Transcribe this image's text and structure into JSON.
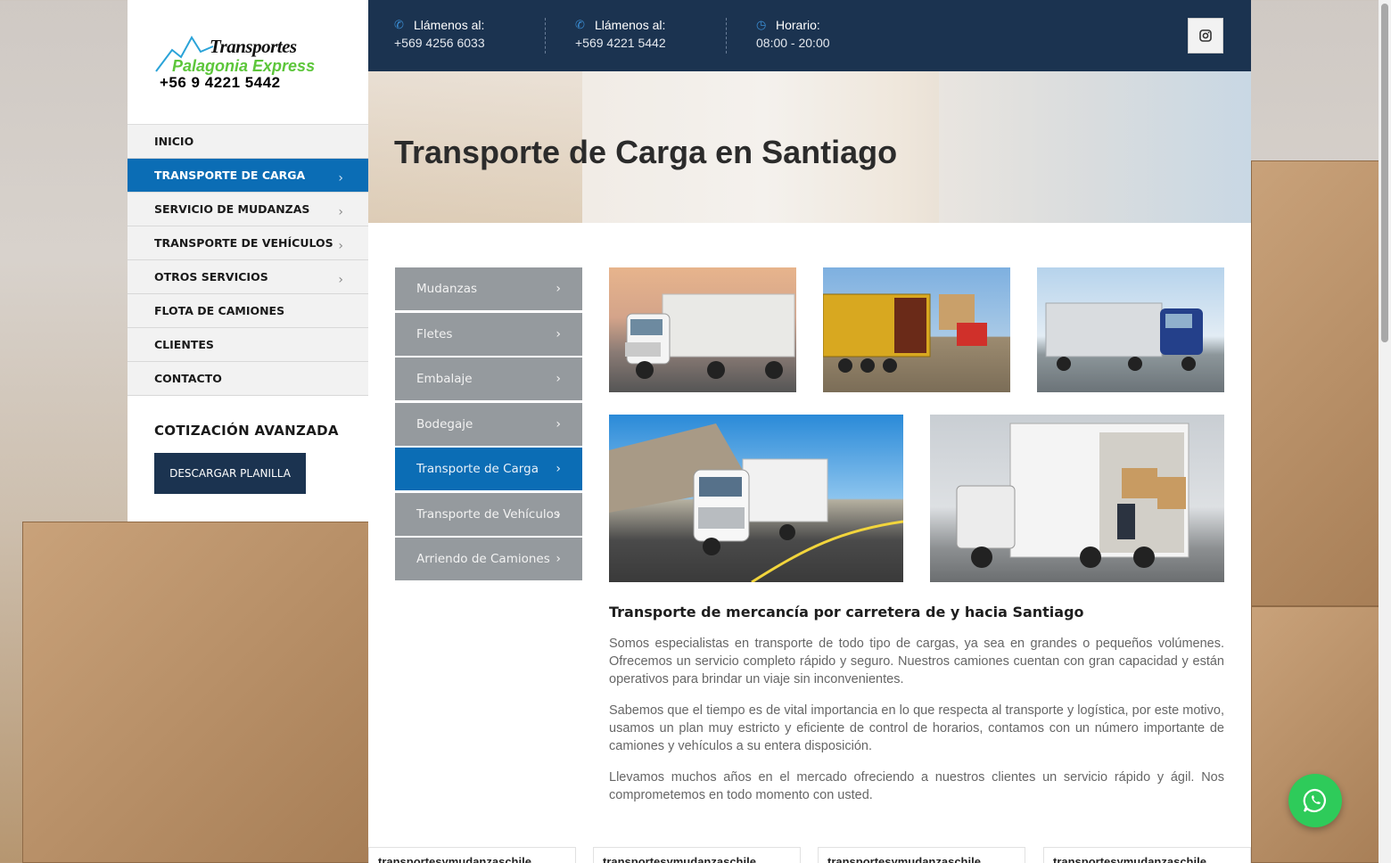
{
  "logo": {
    "line1": "Transportes",
    "line2": "Palagonia Express",
    "phone": "+56 9 4221 5442"
  },
  "nav": {
    "items": [
      {
        "label": "INICIO",
        "active": false,
        "submenu": false
      },
      {
        "label": "TRANSPORTE DE CARGA",
        "active": true,
        "submenu": true
      },
      {
        "label": "SERVICIO DE MUDANZAS",
        "active": false,
        "submenu": true
      },
      {
        "label": "TRANSPORTE DE VEHÍCULOS",
        "active": false,
        "submenu": true
      },
      {
        "label": "OTROS SERVICIOS",
        "active": false,
        "submenu": true
      },
      {
        "label": "FLOTA DE CAMIONES",
        "active": false,
        "submenu": false
      },
      {
        "label": "CLIENTES",
        "active": false,
        "submenu": false
      },
      {
        "label": "CONTACTO",
        "active": false,
        "submenu": false
      }
    ]
  },
  "quote": {
    "title": "COTIZACIÓN AVANZADA",
    "button": "DESCARGAR PLANILLA"
  },
  "topbar": {
    "contacts": [
      {
        "icon": "phone-icon",
        "label": "Llámenos al:",
        "value": "+569 4256 6033"
      },
      {
        "icon": "phone-icon",
        "label": "Llámenos al:",
        "value": "+569 4221 5442"
      },
      {
        "icon": "clock-icon",
        "label": "Horario:",
        "value": "08:00 - 20:00"
      }
    ],
    "social_icon": "instagram-icon"
  },
  "hero": {
    "title": "Transporte de Carga en Santiago"
  },
  "services": {
    "items": [
      {
        "label": "Mudanzas",
        "active": false
      },
      {
        "label": "Fletes",
        "active": false
      },
      {
        "label": "Embalaje",
        "active": false
      },
      {
        "label": "Bodegaje",
        "active": false
      },
      {
        "label": "Transporte de Carga",
        "active": true
      },
      {
        "label": "Transporte de Vehículos",
        "active": false
      },
      {
        "label": "Arriendo de Camiones",
        "active": false
      }
    ]
  },
  "content": {
    "heading": "Transporte de mercancía por carretera de y hacia Santiago",
    "paragraphs": [
      "Somos especialistas en transporte de todo tipo de cargas, ya sea en grandes o pequeños volúmenes. Ofrecemos un servicio completo rápido y seguro. Nuestros camiones cuentan con gran capacidad y están operativos para brindar un viaje sin inconvenientes.",
      "Sabemos que el tiempo es de vital importancia en lo que respecta al transporte y logística, por este motivo, usamos un plan muy estricto y eficiente de control de horarios, contamos con un número importante de camiones y vehículos a su entera disposición.",
      "Llevamos muchos años en el mercado ofreciendo a nuestros clientes un servicio rápido y ágil. Nos comprometemos en todo momento con usted."
    ]
  },
  "cards": {
    "items": [
      "transportesymudanzaschile",
      "transportesymudanzaschile",
      "transportesymudanzaschile",
      "transportesymudanzaschile"
    ]
  },
  "colors": {
    "navy": "#1b3350",
    "accent_blue": "#0b6db5",
    "service_gray": "#959a9e",
    "whatsapp_green": "#2ecb5a"
  }
}
